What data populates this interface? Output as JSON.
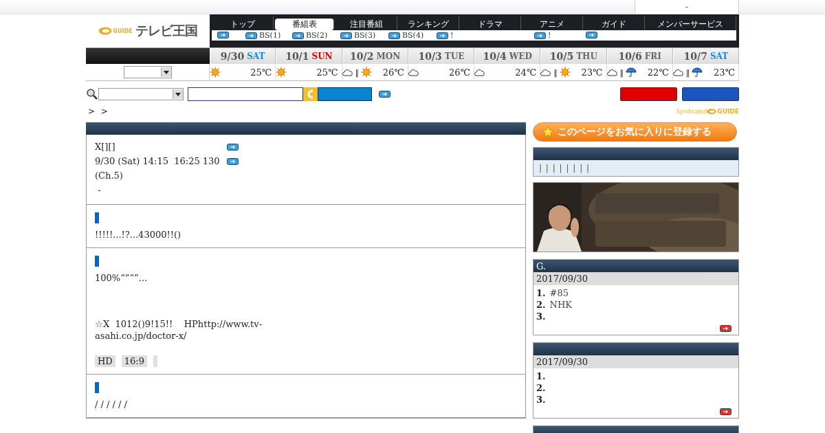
{
  "top_bar": {
    "text": "-"
  },
  "logo": {
    "mark": "GUIDE",
    "title": "テレビ王国"
  },
  "nav": {
    "tabs": [
      {
        "label": "トップ",
        "selected": false
      },
      {
        "label": "番組表",
        "selected": true
      },
      {
        "label": "注目番組",
        "selected": false
      },
      {
        "label": "ランキング",
        "selected": false
      },
      {
        "label": "ドラマ",
        "selected": false
      },
      {
        "label": "アニメ",
        "selected": false
      },
      {
        "label": "ガイド",
        "selected": false
      },
      {
        "label": "メンバーサービス",
        "selected": false
      }
    ],
    "sub_links": [
      {
        "kind": "icon"
      },
      {
        "kind": "labeled",
        "label": "BS(1)"
      },
      {
        "kind": "labeled",
        "label": "BS(2)"
      },
      {
        "kind": "labeled",
        "label": "BS(3)"
      },
      {
        "kind": "labeled",
        "label": "BS(4)"
      },
      {
        "kind": "labeled",
        "label": "!"
      },
      {
        "kind": "labeled",
        "label": "!"
      },
      {
        "kind": "icon"
      }
    ]
  },
  "days": [
    {
      "date": "9/30",
      "weekday": "SAT",
      "kind": "sat",
      "weather": [
        {
          "kind": "sun"
        }
      ],
      "temp": "25℃"
    },
    {
      "date": "10/1",
      "weekday": "SUN",
      "kind": "sun",
      "weather": [
        {
          "kind": "sun"
        }
      ],
      "temp": "25℃"
    },
    {
      "date": "10/2",
      "weekday": "MON",
      "kind": "weekday",
      "weather": [
        {
          "kind": "cloud"
        },
        {
          "kind": "sun"
        }
      ],
      "separator": "‖",
      "temp": "26℃"
    },
    {
      "date": "10/3",
      "weekday": "TUE",
      "kind": "weekday",
      "weather": [
        {
          "kind": "cloud"
        }
      ],
      "temp": "26℃"
    },
    {
      "date": "10/4",
      "weekday": "WED",
      "kind": "weekday",
      "weather": [
        {
          "kind": "cloud"
        }
      ],
      "temp": "24℃"
    },
    {
      "date": "10/5",
      "weekday": "THU",
      "kind": "weekday",
      "weather": [
        {
          "kind": "cloud"
        },
        {
          "kind": "sun"
        }
      ],
      "separator": "‖",
      "temp": "23℃"
    },
    {
      "date": "10/6",
      "weekday": "FRI",
      "kind": "weekday",
      "weather": [
        {
          "kind": "cloud"
        },
        {
          "kind": "rain"
        }
      ],
      "separator": "‖",
      "temp": "22℃"
    },
    {
      "date": "10/7",
      "weekday": "SAT",
      "kind": "sat",
      "weather": [
        {
          "kind": "cloud"
        },
        {
          "kind": "rain"
        }
      ],
      "separator": "‖",
      "temp": "23℃"
    }
  ],
  "breadcrumb": [
    ">",
    ">"
  ],
  "syndicated": {
    "text": "Syndicated",
    "mark": "GUIDE"
  },
  "program": {
    "lines": [
      {
        "text": "X[][]",
        "link": true
      },
      {
        "text": "9/30 (Sat) 14:15  16:25 130",
        "link": true
      },
      {
        "text": "(Ch.5)",
        "link": false
      },
      {
        "text": " -",
        "link": false
      }
    ]
  },
  "sections": [
    {
      "paragraphs": [
        "!!!!!...!?...43000!!()"
      ]
    },
    {
      "paragraphs": [
        "100%“”“”...",
        "☆X  1012()9!15!!    HPhttp://www.tv-asahi.co.jp/doctor-x/"
      ],
      "tags": [
        "HD",
        "16:9"
      ]
    },
    {
      "paragraphs": [
        "/ / / / / /"
      ]
    }
  ],
  "favorite": {
    "label": "このページをお気に入りに登録する"
  },
  "links_panel": {
    "text": "| | | | | | | |"
  },
  "banner": {
    "kind": "picture"
  },
  "rankings": [
    {
      "title": "G.",
      "date": "2017/09/30",
      "items": [
        {
          "num": "1.",
          "text": "#85"
        },
        {
          "num": "2.",
          "text": "NHK"
        },
        {
          "num": "3."
        }
      ]
    },
    {
      "date": "2017/09/30",
      "items": [
        {
          "num": "1."
        },
        {
          "num": "2."
        },
        {
          "num": "3."
        }
      ]
    }
  ]
}
